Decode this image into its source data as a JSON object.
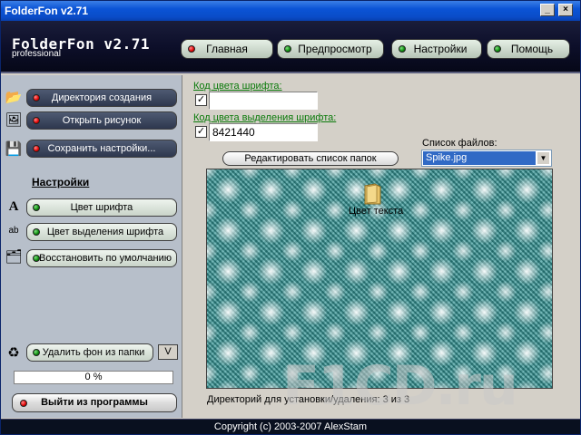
{
  "window": {
    "title": "FolderFon v2.71"
  },
  "header": {
    "logo": "FolderFon v2.71",
    "logo_sub": "professional",
    "tabs": [
      {
        "label": "Главная",
        "led": "red"
      },
      {
        "label": "Предпросмотр",
        "led": "green"
      },
      {
        "label": "Настройки",
        "led": "green"
      },
      {
        "label": "Помощь",
        "led": "green"
      }
    ]
  },
  "sidebar": {
    "actions": [
      {
        "label": "Директория создания",
        "led": "red",
        "icon": "folder-arrow-icon"
      },
      {
        "label": "Открыть рисунок",
        "led": "red",
        "icon": "open-image-icon"
      },
      {
        "label": "Сохранить настройки...",
        "led": "red",
        "icon": "save-settings-icon"
      }
    ],
    "settings_title": "Настройки",
    "settings": [
      {
        "label": "Цвет шрифта",
        "icon": "font-color-icon"
      },
      {
        "label": "Цвет выделения шрифта",
        "icon": "highlight-color-icon"
      },
      {
        "label": "Восстановить по умолчанию",
        "icon": "restore-defaults-icon"
      }
    ],
    "remove_bg": "Удалить фон из папки",
    "remove_bg_shortcut": "V",
    "progress_text": "0 %",
    "progress_value": 0,
    "exit": "Выйти из программы"
  },
  "main": {
    "font_color_link": "Код цвета шрифта:",
    "font_color_value": "",
    "highlight_link": "Код цвета выделения шрифта:",
    "highlight_value": "8421440",
    "edit_folders_button": "Редактировать список папок",
    "files_label": "Список файлов:",
    "files_selected": "Spike.jpg",
    "preview_folder_label": "Цвет текста",
    "status": "Директорий для установки/удаления: 3 из 3"
  },
  "footer": {
    "copyright": "Copyright (c) 2003-2007 AlexStam"
  },
  "watermark": "F1CD.ru",
  "colors": {
    "title_bar": "#0b54d6",
    "header_bg": "#0d0f2a",
    "sidebar_bg": "#b7bfca",
    "preview_bg": "#4f9a9a",
    "link": "#0a7a0a"
  }
}
